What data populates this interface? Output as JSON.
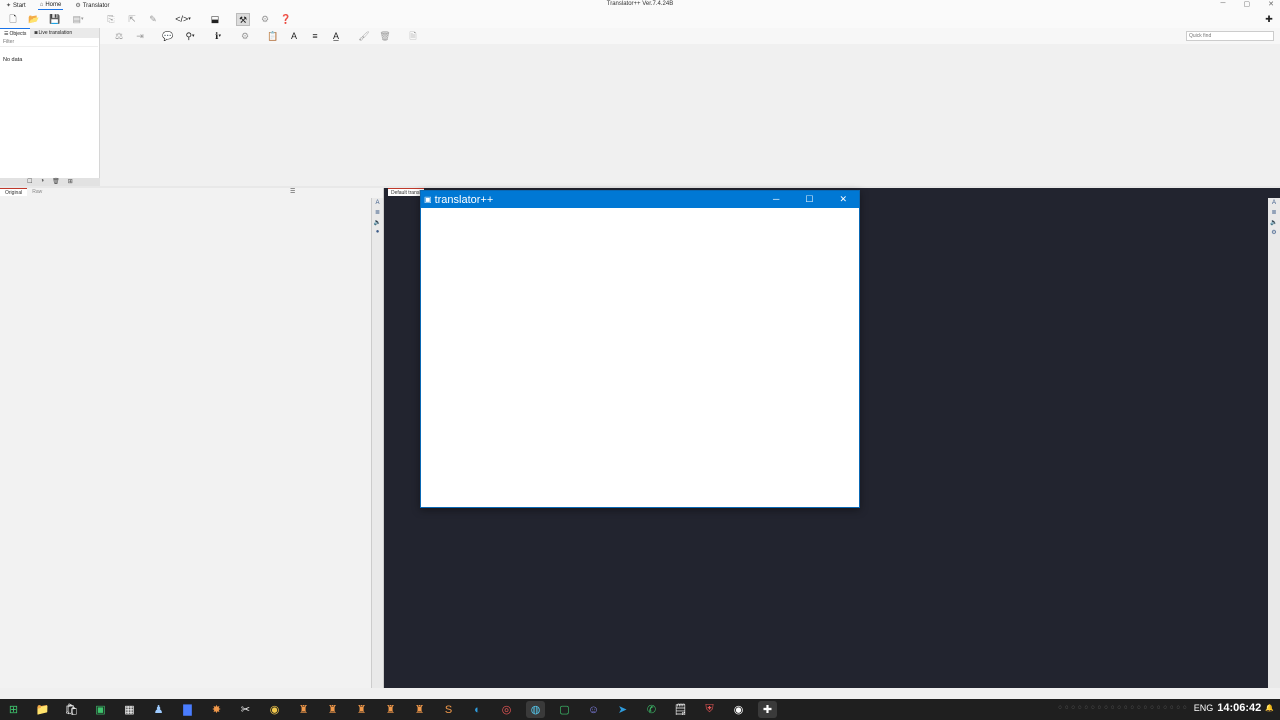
{
  "menu": {
    "items": [
      {
        "label": "Start",
        "icon": "start-icon"
      },
      {
        "label": "Home",
        "icon": "home-icon"
      },
      {
        "label": "Translator",
        "icon": "translator-icon"
      }
    ]
  },
  "app": {
    "title": "Translator++ Ver.7.4.24B"
  },
  "toolbar": {
    "quick_find_placeholder": "Quick find"
  },
  "objects_panel": {
    "tabs": [
      {
        "label": "Objects"
      },
      {
        "label": "Live translation"
      }
    ],
    "filter_placeholder": "Filter",
    "empty_text": "No data"
  },
  "editor": {
    "tabs": [
      {
        "label": "Original"
      },
      {
        "label": "Raw"
      }
    ]
  },
  "preview": {
    "tab_label": "Default translation"
  },
  "modal": {
    "title": "translator++",
    "title_color": "#0078d4"
  },
  "taskbar": {
    "language": "ENG",
    "time": "14:06:42"
  },
  "colors": {
    "accent": "#0078d4",
    "preview_bg": "#22242f",
    "taskbar_bg": "#1f1f1f"
  }
}
